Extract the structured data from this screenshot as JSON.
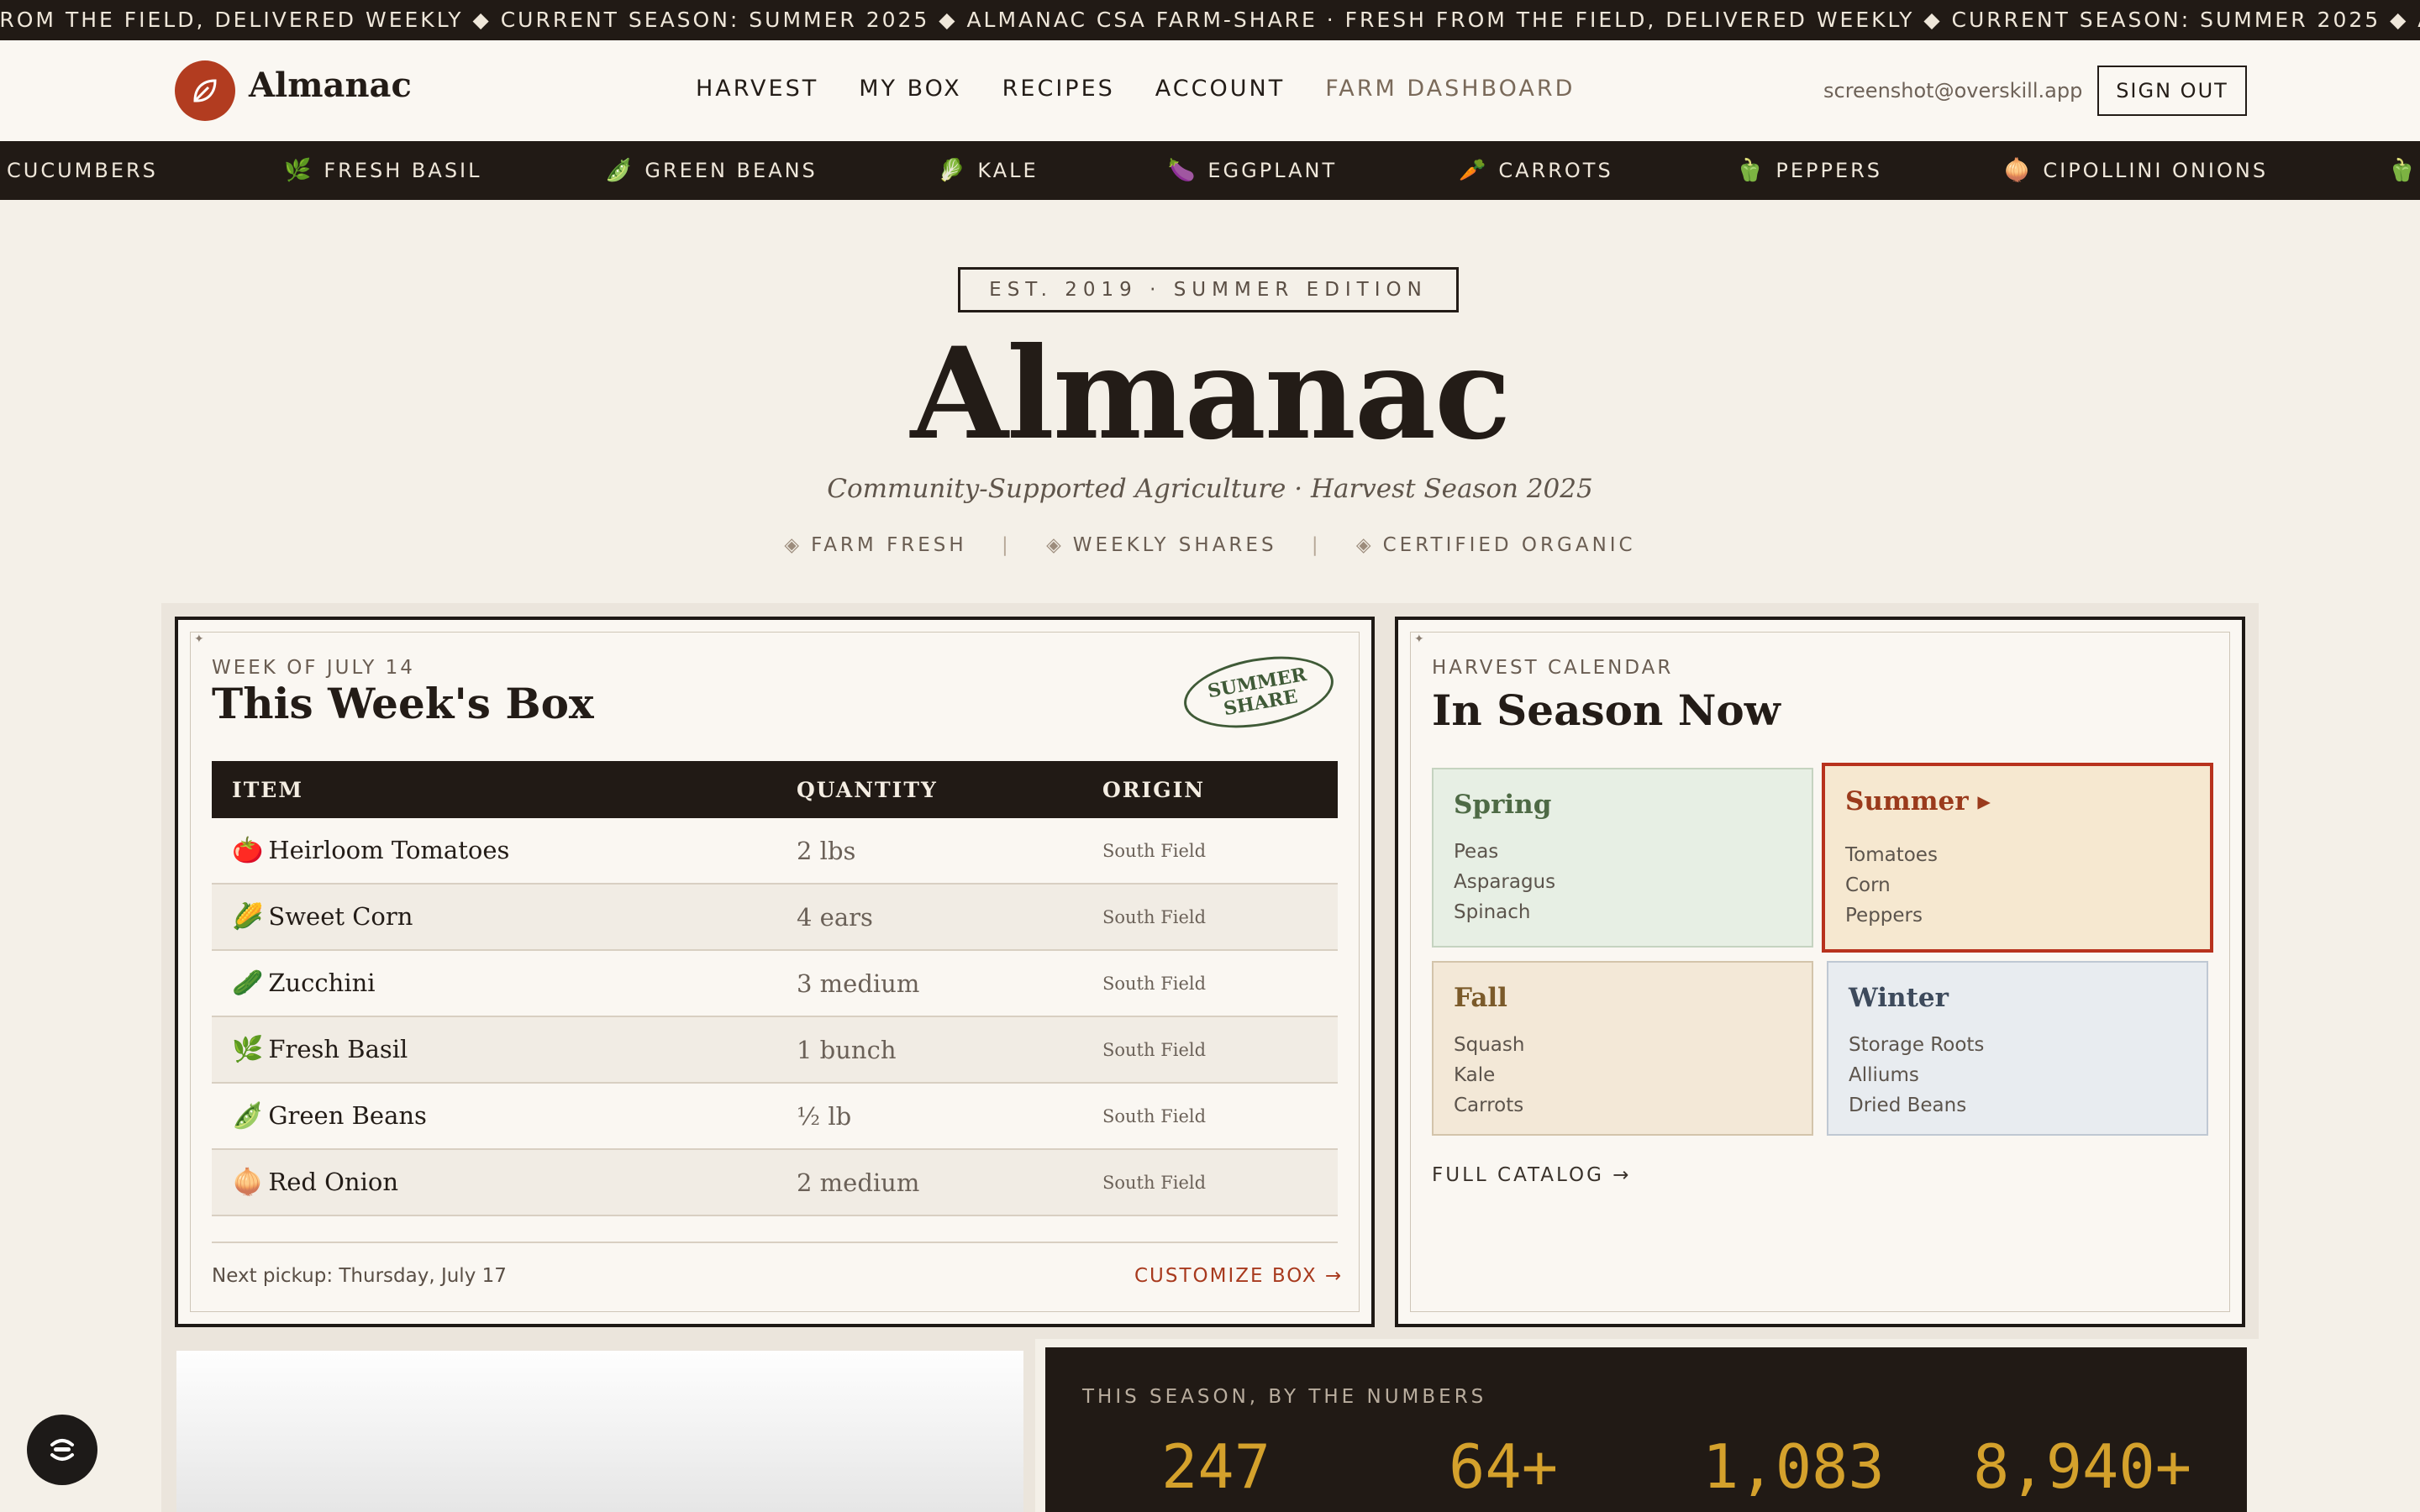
{
  "marquee": {
    "text": "FROM THE FIELD, DELIVERED WEEKLY  ◆  CURRENT SEASON: SUMMER 2025  ◆  ALMANAC CSA FARM-SHARE · FRESH FROM THE FIELD, DELIVERED WEEKLY  ◆  CURRENT SEASON: SUMMER 2025  ◆  ALMANAC CSA FARM-SHARE"
  },
  "header": {
    "brand": "Almanac",
    "nav": [
      "HARVEST",
      "MY BOX",
      "RECIPES",
      "ACCOUNT",
      "FARM DASHBOARD"
    ],
    "user_email": "screenshot@overskill.app",
    "signout_label": "SIGN OUT"
  },
  "produce_strip": [
    {
      "icon": "",
      "label": "CUCUMBERS"
    },
    {
      "icon": "🌿",
      "label": "FRESH BASIL"
    },
    {
      "icon": "🫛",
      "label": "GREEN BEANS"
    },
    {
      "icon": "🥬",
      "label": "KALE"
    },
    {
      "icon": "🍆",
      "label": "EGGPLANT"
    },
    {
      "icon": "🥕",
      "label": "CARROTS"
    },
    {
      "icon": "🫑",
      "label": "PEPPERS"
    },
    {
      "icon": "🧅",
      "label": "CIPOLLINI ONIONS"
    },
    {
      "icon": "🫑",
      "label": ""
    }
  ],
  "hero": {
    "est": "EST. 2019 · SUMMER EDITION",
    "title": "Almanac",
    "subtitle": "Community-Supported Agriculture · Harvest Season 2025",
    "badges": [
      "FARM FRESH",
      "WEEKLY SHARES",
      "CERTIFIED ORGANIC"
    ]
  },
  "box": {
    "eyebrow": "WEEK OF JULY 14",
    "title": "This Week's Box",
    "stamp": [
      "SUMMER",
      "SHARE"
    ],
    "columns": [
      "ITEM",
      "QUANTITY",
      "ORIGIN"
    ],
    "rows": [
      {
        "emoji": "🍅",
        "item": "Heirloom Tomatoes",
        "qty": "2 lbs",
        "origin": "South Field"
      },
      {
        "emoji": "🌽",
        "item": "Sweet Corn",
        "qty": "4 ears",
        "origin": "South Field"
      },
      {
        "emoji": "🥒",
        "item": "Zucchini",
        "qty": "3 medium",
        "origin": "South Field"
      },
      {
        "emoji": "🌿",
        "item": "Fresh Basil",
        "qty": "1 bunch",
        "origin": "South Field"
      },
      {
        "emoji": "🫛",
        "item": "Green Beans",
        "qty": "½ lb",
        "origin": "South Field"
      },
      {
        "emoji": "🧅",
        "item": "Red Onion",
        "qty": "2 medium",
        "origin": "South Field"
      }
    ],
    "next_pickup": "Next pickup: Thursday, July 17",
    "customize_label": "CUSTOMIZE BOX →"
  },
  "calendar": {
    "eyebrow": "HARVEST CALENDAR",
    "title": "In Season Now",
    "seasons": [
      {
        "name": "Spring",
        "items": [
          "Peas",
          "Asparagus",
          "Spinach"
        ],
        "bg": "#e7efe4",
        "border": "#c5d3c0",
        "color": "#4e6a45"
      },
      {
        "name": "Summer ▸",
        "items": [
          "Tomatoes",
          "Corn",
          "Peppers"
        ],
        "bg": "#f6e8d0",
        "border": "#b8321d",
        "color": "#9a3a1c"
      },
      {
        "name": "Fall",
        "items": [
          "Squash",
          "Kale",
          "Carrots"
        ],
        "bg": "#f3e8d7",
        "border": "#d3c4ab",
        "color": "#7b5a2a"
      },
      {
        "name": "Winter",
        "items": [
          "Storage Roots",
          "Alliums",
          "Dried Beans"
        ],
        "bg": "#e8ecf0",
        "border": "#bfc8d3",
        "color": "#3d4a5c"
      }
    ],
    "catalog_label": "FULL CATALOG →"
  },
  "numbers": {
    "eyebrow": "THIS SEASON, BY THE NUMBERS",
    "values": [
      "247",
      "64+",
      "1,083",
      "8,940+"
    ]
  },
  "colors": {
    "accent": "#b23c20",
    "dark": "#211a15",
    "gold": "#d4a12c",
    "paper": "#f4f0e8"
  }
}
